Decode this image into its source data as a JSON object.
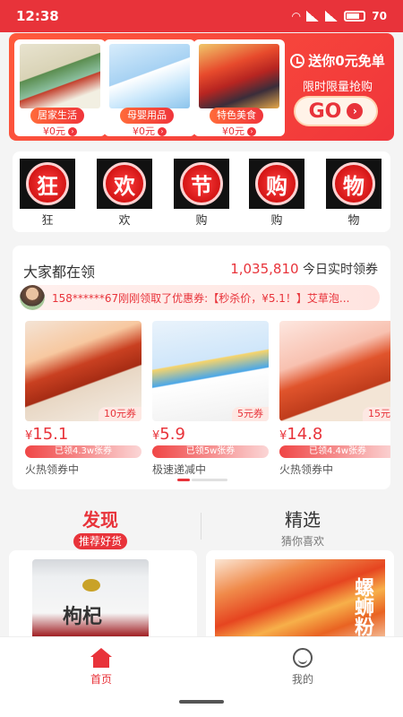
{
  "status": {
    "time": "12:38",
    "battery": "70"
  },
  "banner": {
    "cards": [
      {
        "tag": "居家生活",
        "price": "¥0元"
      },
      {
        "tag": "母婴用品",
        "price": "¥0元"
      },
      {
        "tag": "特色美食",
        "price": "¥0元"
      }
    ],
    "promo_title": "送你0元免单",
    "promo_sub": "限时限量抢购",
    "go_label": "GO"
  },
  "festival": {
    "items": [
      {
        "char": "狂",
        "label": "狂"
      },
      {
        "char": "欢",
        "label": "欢"
      },
      {
        "char": "节",
        "label": "购"
      },
      {
        "char": "购",
        "label": "购"
      },
      {
        "char": "物",
        "label": "物"
      }
    ]
  },
  "coupons": {
    "title": "大家都在领",
    "count": "1,035,810",
    "count_suffix": " 今日实时领券",
    "ticker": "158******67刚刚领取了优惠券:【秒杀价，¥5.1！】艾草泡...",
    "products": [
      {
        "coupon": "10元券",
        "price": "15.1",
        "claimed": "已领4.3w张券",
        "status": "火热领券中"
      },
      {
        "coupon": "5元券",
        "price": "5.9",
        "claimed": "已领5w张券",
        "status": "极速递减中"
      },
      {
        "coupon": "15元",
        "price": "14.8",
        "claimed": "已领4.4w张券",
        "status": "火热领券中"
      }
    ],
    "currency": "¥"
  },
  "tabs": {
    "discover": {
      "title": "发现",
      "sub": "推荐好货"
    },
    "picks": {
      "title": "精选",
      "sub": "猜你喜欢"
    }
  },
  "feed": {
    "items": [
      {
        "label": "枸杞"
      },
      {
        "label": "螺蛳粉"
      }
    ]
  },
  "nav": {
    "home": "首页",
    "me": "我的"
  },
  "colors": {
    "accent": "#e8333a"
  }
}
